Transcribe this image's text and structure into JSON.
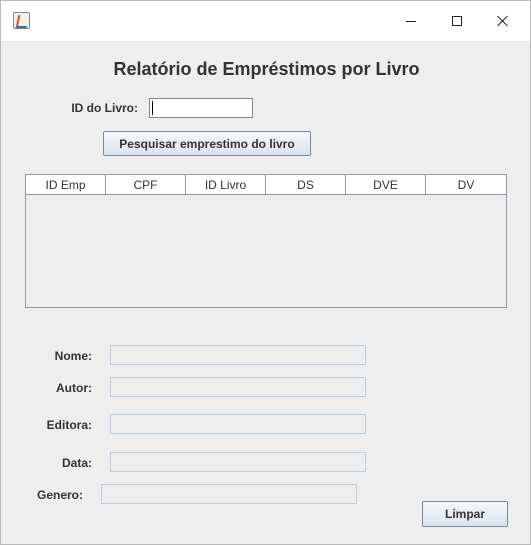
{
  "window": {
    "controls": {
      "minimize": "minimize-icon",
      "maximize": "maximize-icon",
      "close": "close-icon"
    }
  },
  "header": {
    "title": "Relatório de Empréstimos por Livro"
  },
  "search": {
    "id_label": "ID do Livro:",
    "id_value": "",
    "search_button": "Pesquisar emprestimo do livro"
  },
  "table": {
    "columns": [
      "ID Emp",
      "CPF",
      "ID Livro",
      "DS",
      "DVE",
      "DV"
    ],
    "rows": []
  },
  "details": {
    "nome_label": "Nome:",
    "autor_label": "Autor:",
    "editora_label": "Editora:",
    "data_label": "Data:",
    "genero_label": "Genero:",
    "nome_value": "",
    "autor_value": "",
    "editora_value": "",
    "data_value": "",
    "genero_value": ""
  },
  "actions": {
    "clear_button": "Limpar"
  }
}
